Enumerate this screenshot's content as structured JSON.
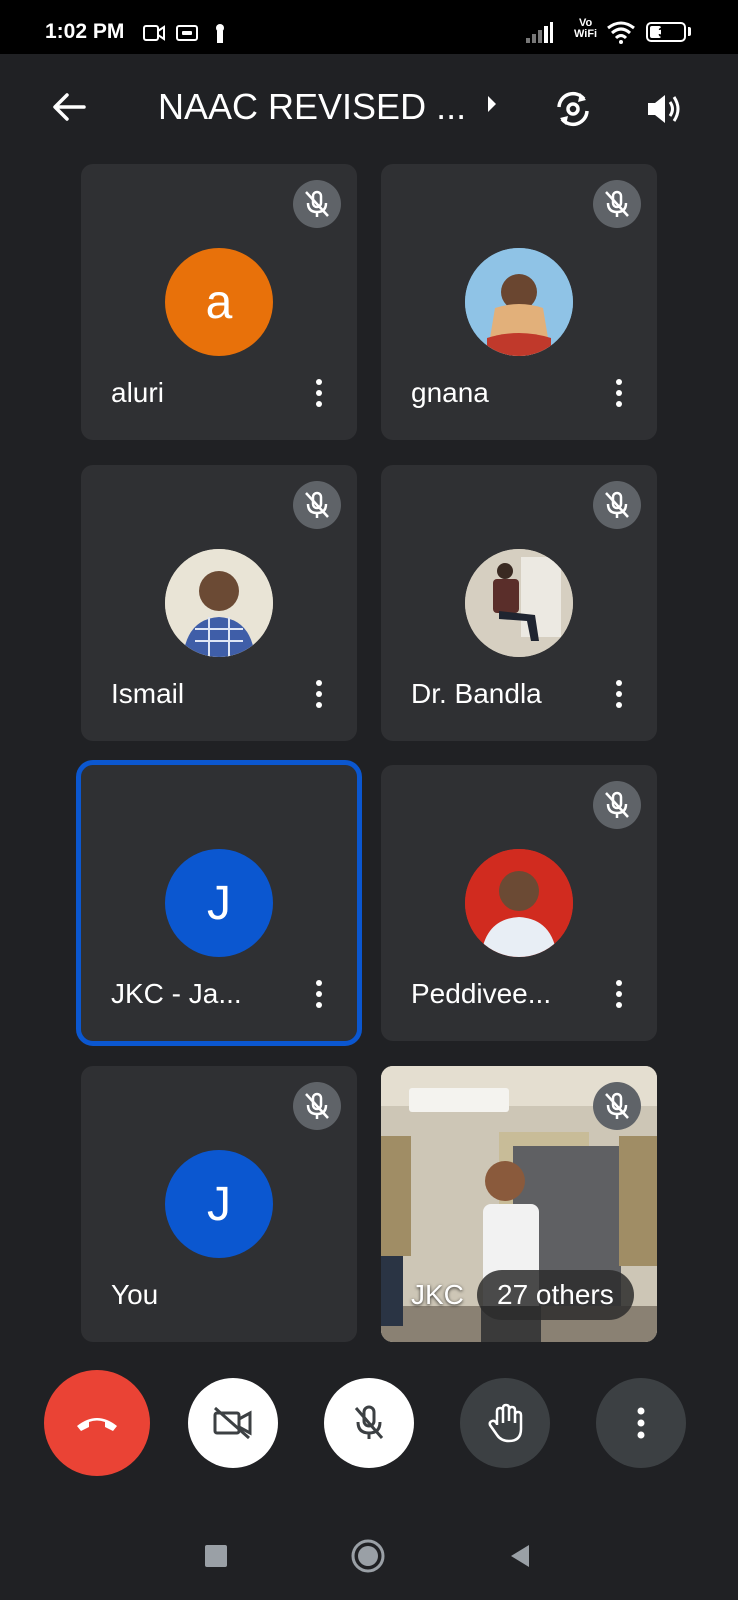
{
  "status_bar": {
    "time": "1:02 PM",
    "network_label_top": "Vo",
    "network_label_bottom": "WiFi",
    "battery": "35",
    "battery_level": 0.35
  },
  "header": {
    "title": "NAAC REVISED ...",
    "back_icon": "arrow-left-icon",
    "switch_camera_icon": "switch-camera-icon",
    "speaker_icon": "speaker-icon"
  },
  "participants": [
    {
      "name": "aluri",
      "initial": "a",
      "avatar_color": "#e8710a",
      "muted": true
    },
    {
      "name": "gnana",
      "initial": "",
      "avatar_color": "#7fb2d8",
      "muted": true
    },
    {
      "name": "Ismail",
      "initial": "",
      "avatar_color": "#d8d1c0",
      "muted": true
    },
    {
      "name": "Dr. Bandla",
      "initial": "",
      "avatar_color": "#cfc8bb",
      "muted": true
    },
    {
      "name": "JKC - Ja...",
      "initial": "J",
      "avatar_color": "#0b57d0",
      "muted": false,
      "speaking": true
    },
    {
      "name": "Peddivee...",
      "initial": "",
      "avatar_color": "#c0392b",
      "muted": true
    },
    {
      "name": "You",
      "initial": "J",
      "avatar_color": "#0b57d0",
      "muted": true
    }
  ],
  "others_tile": {
    "label": "JKC",
    "count_label": "27 others",
    "muted": true
  },
  "controls": {
    "end_call_icon": "end-call-icon",
    "camera_icon": "camera-off-icon",
    "mic_icon": "mic-off-icon",
    "hand_icon": "raise-hand-icon",
    "more_icon": "more-vert-icon"
  },
  "colors": {
    "background": "#202124",
    "tile": "#2f3033",
    "end_call": "#ea4335",
    "active_speaker": "#0b57d0"
  }
}
